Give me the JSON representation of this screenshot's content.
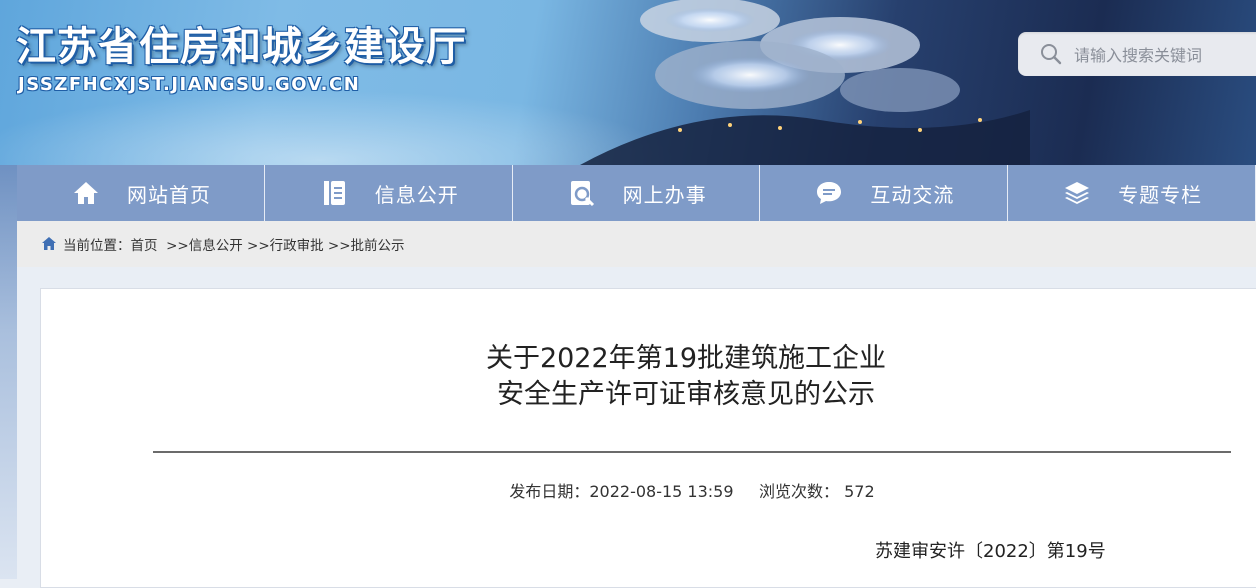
{
  "header": {
    "site_title": "江苏省住房和城乡建设厅",
    "domain": "JSSZFHCXJST.JIANGSU.GOV.CN",
    "search_placeholder": "请输入搜索关键词"
  },
  "nav": [
    {
      "label": "网站首页",
      "icon": "home-icon"
    },
    {
      "label": "信息公开",
      "icon": "document-icon"
    },
    {
      "label": "网上办事",
      "icon": "search-doc-icon"
    },
    {
      "label": "互动交流",
      "icon": "chat-icon"
    },
    {
      "label": "专题专栏",
      "icon": "layers-icon"
    }
  ],
  "breadcrumb": {
    "prefix": "当前位置：",
    "items": [
      "首页",
      "  >>信息公开",
      " >>行政审批",
      " >>批前公示"
    ]
  },
  "article": {
    "title_line1": "关于2022年第19批建筑施工企业",
    "title_line2": "安全生产许可证审核意见的公示",
    "publish_label": "发布日期：",
    "publish_date": "2022-08-15 13:59",
    "views_label": "浏览次数：",
    "views": "572",
    "doc_number": "苏建审安许〔2022〕第19号"
  },
  "colors": {
    "nav_bg": "#7f9bc8",
    "crumb_bg": "#ececec"
  }
}
